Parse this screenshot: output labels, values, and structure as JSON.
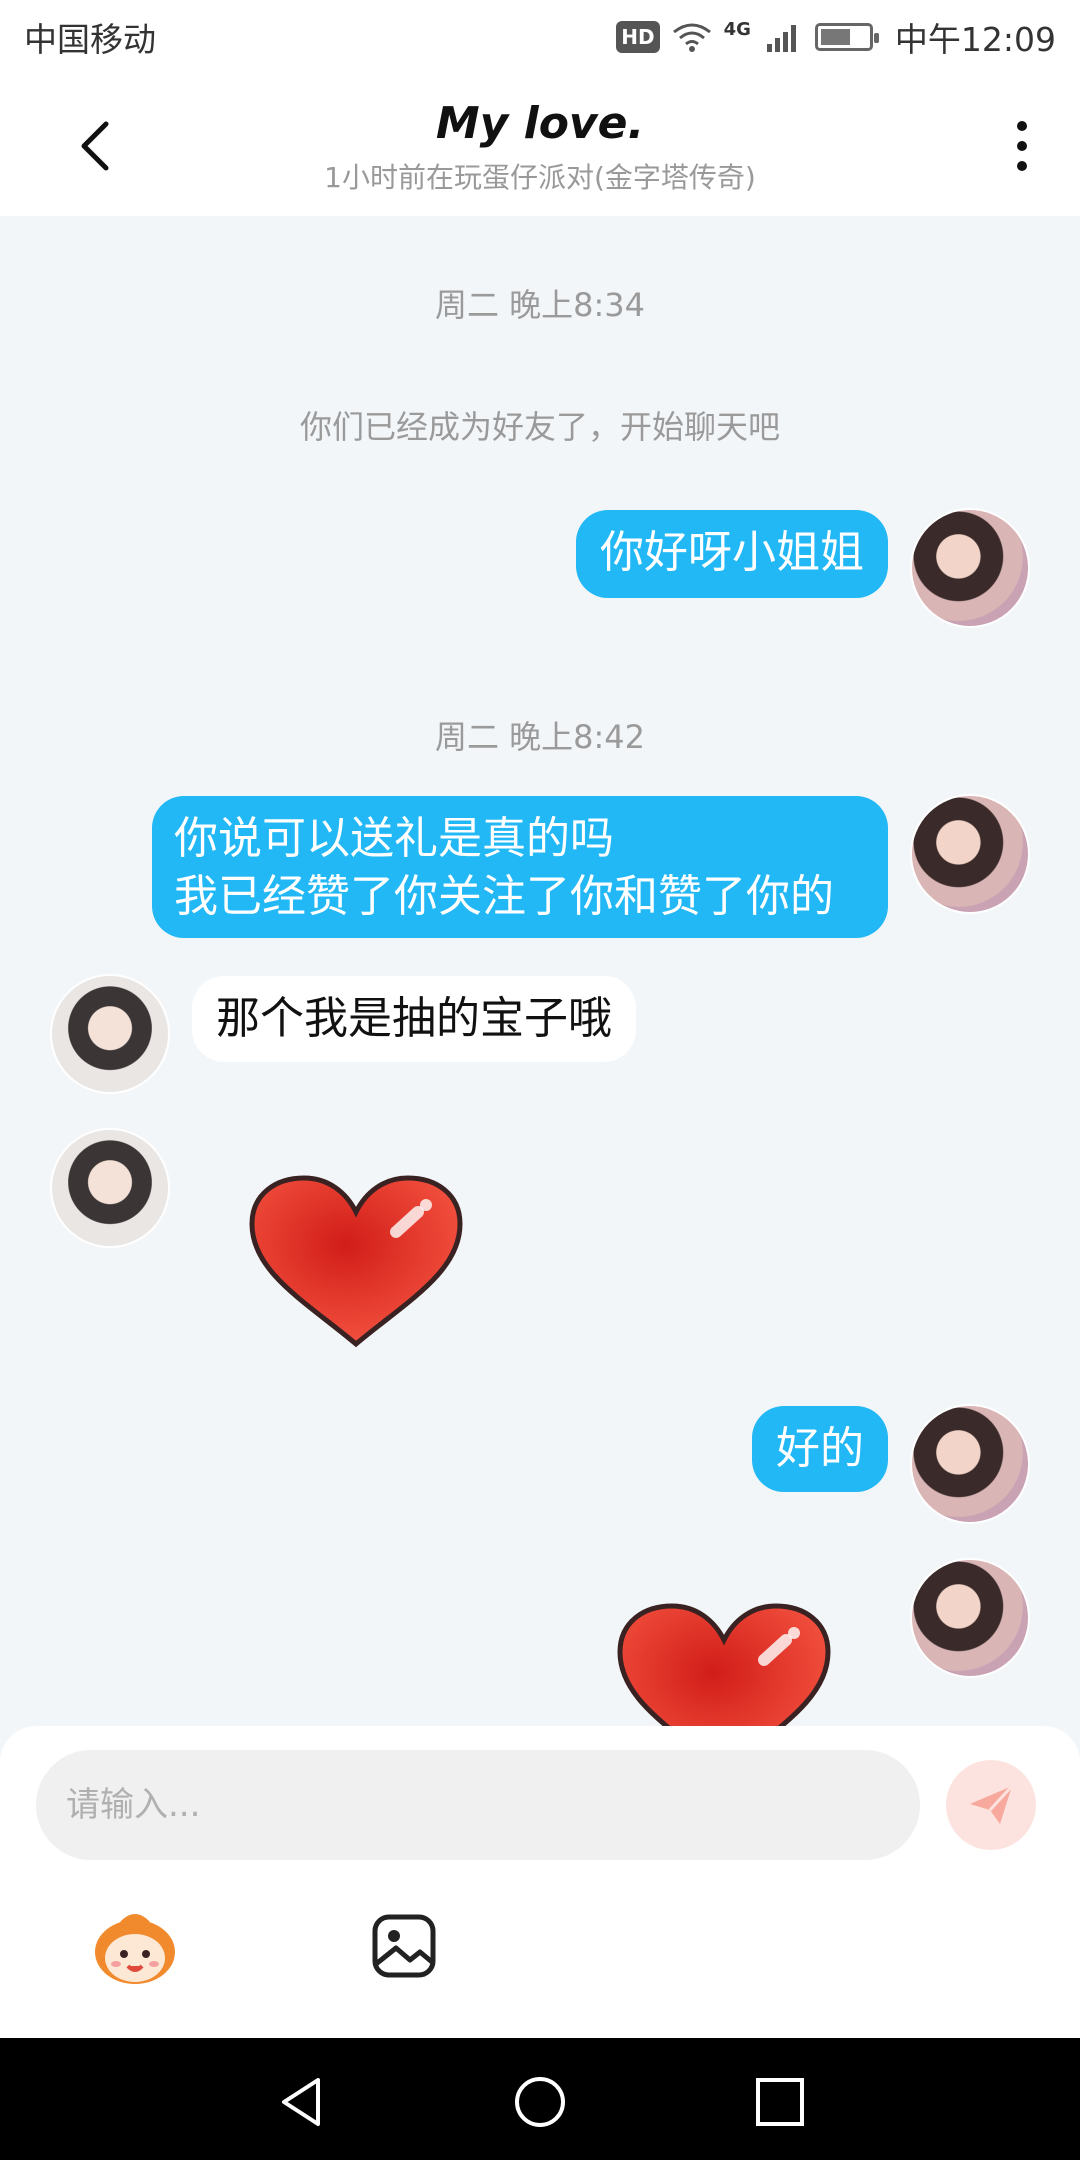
{
  "status_bar": {
    "carrier": "中国移动",
    "hd_label": "HD",
    "network": "4G",
    "time": "中午12:09",
    "battery_level": 0.62
  },
  "header": {
    "title": "My love.",
    "subtitle": "1小时前在玩蛋仔派对(金字塔传奇)"
  },
  "chat": {
    "time_1": "周二 晚上8:34",
    "system_message": "你们已经成为好友了，开始聊天吧",
    "msg_1": "你好呀小姐姐",
    "time_2": "周二 晚上8:42",
    "msg_2_line1": "你说可以送礼是真的吗",
    "msg_2_line2": "我已经赞了你关注了你和赞了你的",
    "msg_3": "那个我是抽的宝子哦",
    "msg_5": "好的"
  },
  "composer": {
    "placeholder": "请输入..."
  },
  "colors": {
    "outgoing_bubble": "#22b8f5",
    "send_button": "#fde3df",
    "send_icon": "#f6a99c",
    "heart": "#e53a2e"
  }
}
